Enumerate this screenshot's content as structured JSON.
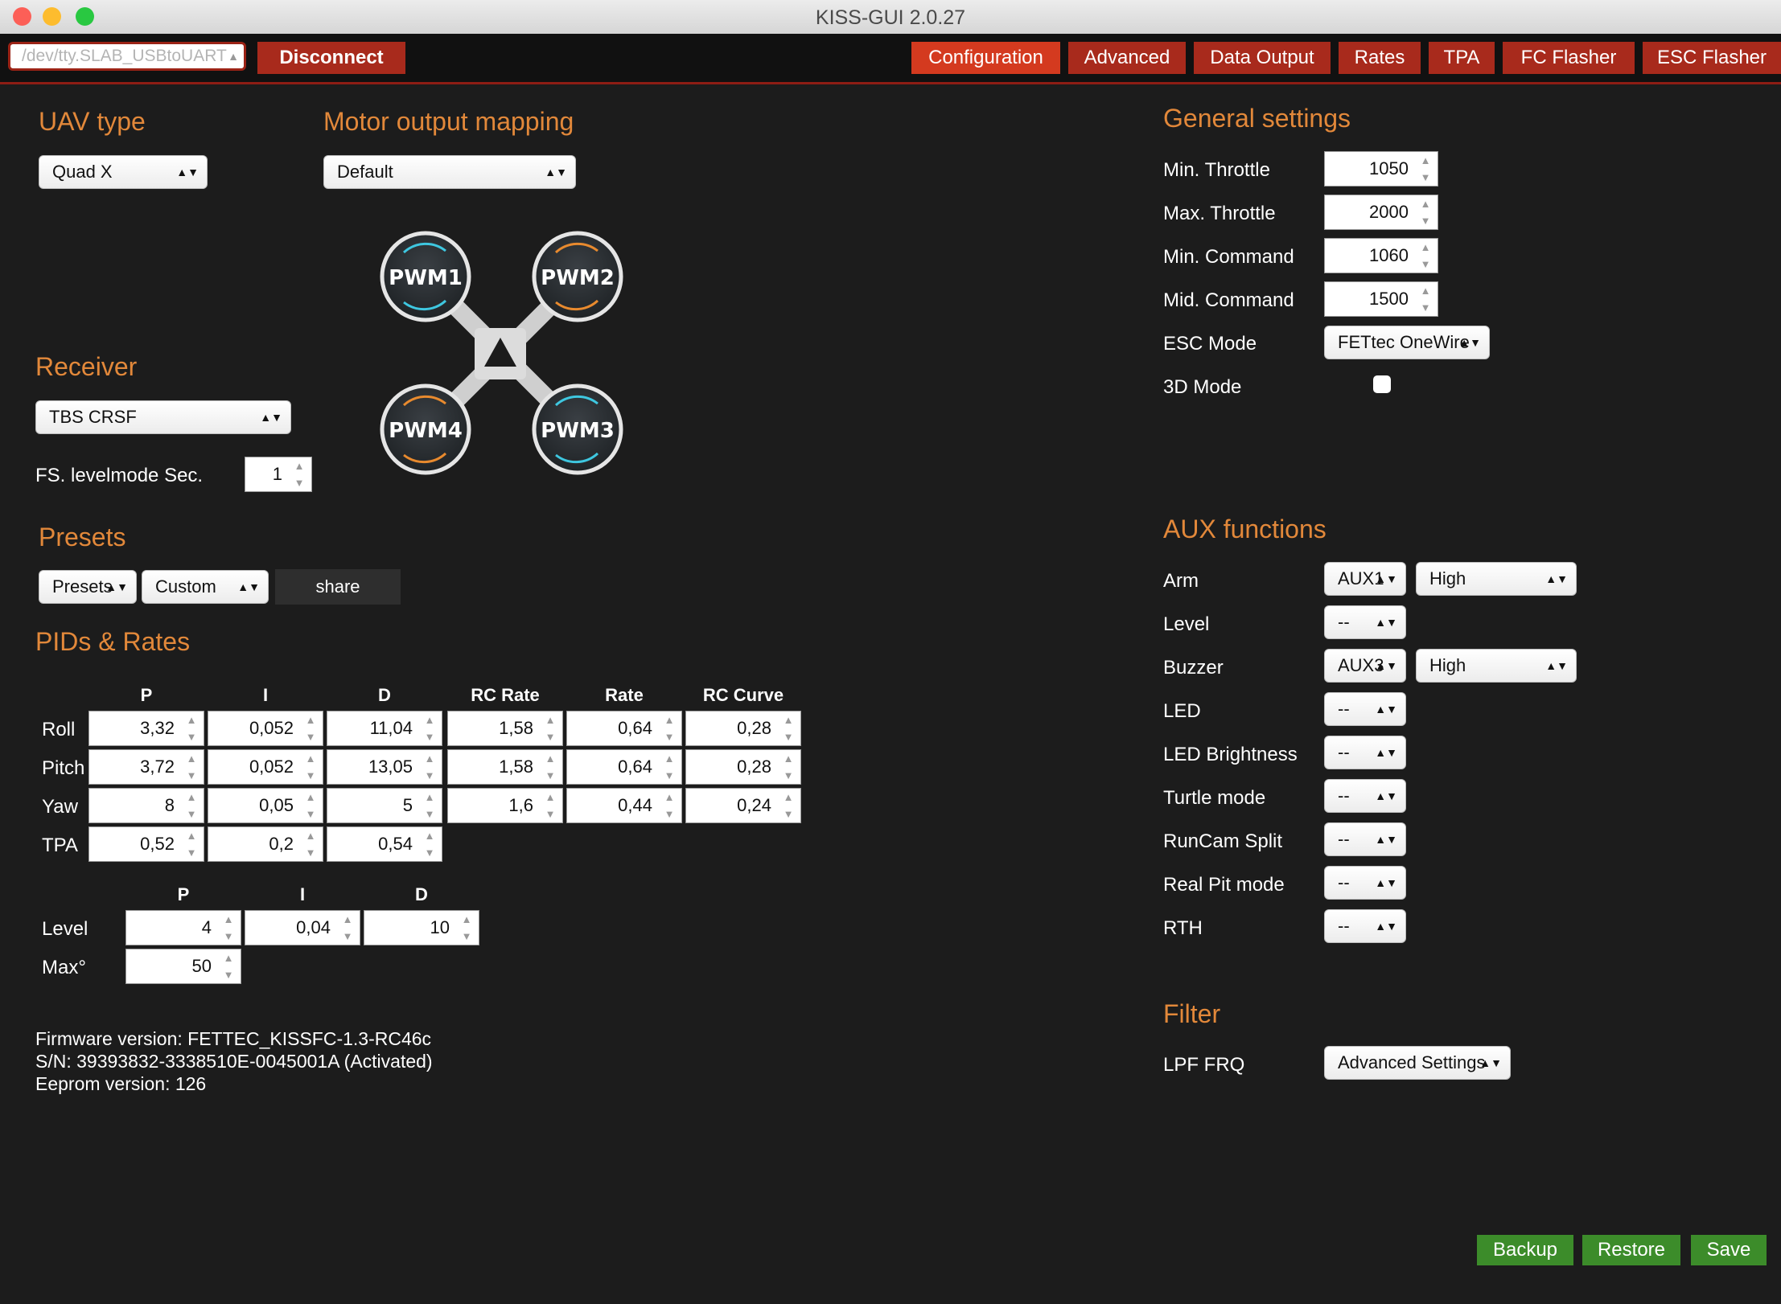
{
  "window": {
    "title": "KISS-GUI 2.0.27"
  },
  "toolbar": {
    "port_value": "/dev/tty.SLAB_USBtoUART",
    "disconnect_label": "Disconnect",
    "tabs": [
      "Configuration",
      "Advanced",
      "Data Output",
      "Rates",
      "TPA",
      "FC Flasher",
      "ESC Flasher"
    ],
    "active_tab": "Configuration"
  },
  "uav": {
    "heading": "UAV type",
    "type_value": "Quad X"
  },
  "motor": {
    "heading": "Motor output mapping",
    "mapping_value": "Default",
    "motors": [
      "PWM1",
      "PWM2",
      "PWM3",
      "PWM4"
    ]
  },
  "receiver": {
    "heading": "Receiver",
    "value": "TBS CRSF",
    "fs_label": "FS. levelmode Sec.",
    "fs_value": "1"
  },
  "presets": {
    "heading": "Presets",
    "presets_value": "Presets",
    "custom_value": "Custom",
    "share_label": "share"
  },
  "pids": {
    "heading": "PIDs & Rates",
    "columns": [
      "P",
      "I",
      "D",
      "RC Rate",
      "Rate",
      "RC Curve"
    ],
    "rows": [
      {
        "label": "Roll",
        "values": [
          "3,32",
          "0,052",
          "11,04",
          "1,58",
          "0,64",
          "0,28"
        ]
      },
      {
        "label": "Pitch",
        "values": [
          "3,72",
          "0,052",
          "13,05",
          "1,58",
          "0,64",
          "0,28"
        ]
      },
      {
        "label": "Yaw",
        "values": [
          "8",
          "0,05",
          "5",
          "1,6",
          "0,44",
          "0,24"
        ]
      },
      {
        "label": "TPA",
        "values": [
          "0,52",
          "0,2",
          "0,54"
        ]
      }
    ],
    "level_columns": [
      "P",
      "I",
      "D"
    ],
    "level_rows": [
      {
        "label": "Level",
        "values": [
          "4",
          "0,04",
          "10"
        ]
      },
      {
        "label": "Max°",
        "values": [
          "50"
        ]
      }
    ]
  },
  "firmware": {
    "version": "Firmware version: FETTEC_KISSFC-1.3-RC46c",
    "serial": "S/N: 39393832-3338510E-0045001A (Activated)",
    "eeprom": "Eeprom version: 126"
  },
  "general": {
    "heading": "General settings",
    "min_throttle_label": "Min. Throttle",
    "min_throttle": "1050",
    "max_throttle_label": "Max. Throttle",
    "max_throttle": "2000",
    "min_command_label": "Min. Command",
    "min_command": "1060",
    "mid_command_label": "Mid. Command",
    "mid_command": "1500",
    "esc_mode_label": "ESC Mode",
    "esc_mode": "FETtec OneWire",
    "mode3d_label": "3D Mode",
    "mode3d_checked": false
  },
  "aux": {
    "heading": "AUX functions",
    "items": [
      {
        "label": "Arm",
        "channel": "AUX1",
        "state": "High"
      },
      {
        "label": "Level",
        "channel": "--"
      },
      {
        "label": "Buzzer",
        "channel": "AUX3",
        "state": "High"
      },
      {
        "label": "LED",
        "channel": "--"
      },
      {
        "label": "LED Brightness",
        "channel": "--"
      },
      {
        "label": "Turtle mode",
        "channel": "--"
      },
      {
        "label": "RunCam Split",
        "channel": "--"
      },
      {
        "label": "Real Pit mode",
        "channel": "--"
      },
      {
        "label": "RTH",
        "channel": "--"
      }
    ]
  },
  "filter": {
    "heading": "Filter",
    "lpf_label": "LPF FRQ",
    "lpf_value": "Advanced Settings"
  },
  "actions": {
    "backup_label": "Backup",
    "restore_label": "Restore",
    "save_label": "Save"
  },
  "colors": {
    "accent": "#e2883a",
    "toolbar_red": "#a82a1c",
    "active_tab": "#d43a1f",
    "green": "#3c8c2a",
    "background": "#1c1c1c"
  }
}
